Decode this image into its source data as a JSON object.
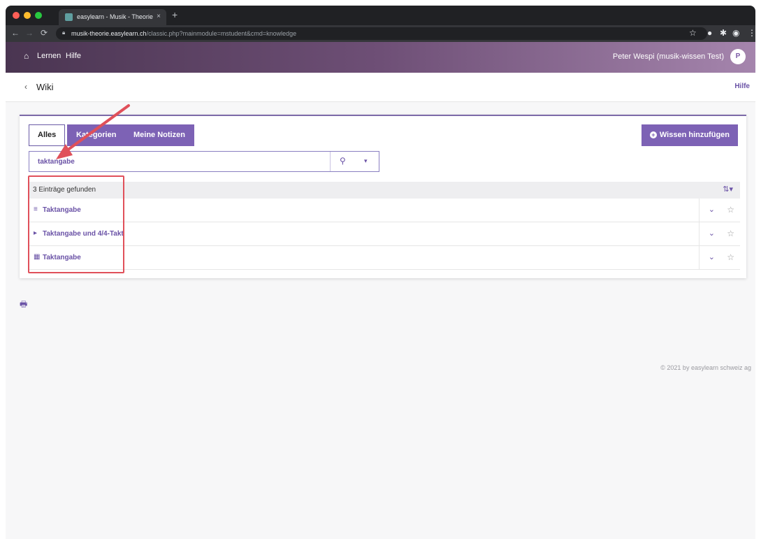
{
  "browser": {
    "tab_title": "easylearn - Musik - Theorie",
    "tab_close": "×",
    "new_tab": "+",
    "url_host": "musik-theorie.easylearn.ch",
    "url_path": "/classic.php?mainmodule=mstudent&cmd=knowledge"
  },
  "header": {
    "nav": [
      "Lernen",
      "Hilfe"
    ],
    "user": "Peter Wespi (musik-wissen Test)",
    "avatar": "P"
  },
  "page": {
    "title": "Wiki",
    "help": "Hilfe"
  },
  "tabs": [
    "Alles",
    "Kategorien",
    "Meine Notizen"
  ],
  "add_button": "Wissen hinzufügen",
  "search": {
    "value": "taktangabe"
  },
  "results": {
    "count": "3 Einträge gefunden",
    "items": [
      {
        "label": "Taktangabe",
        "icon": "text-icon"
      },
      {
        "label": "Taktangabe und 4/4-Takt",
        "icon": "play-icon"
      },
      {
        "label": "Taktangabe",
        "icon": "media-icon"
      }
    ]
  },
  "footer": "© 2021 by easylearn schweiz ag",
  "colors": {
    "accent": "#7d62b5",
    "annotation": "#e0505a"
  }
}
